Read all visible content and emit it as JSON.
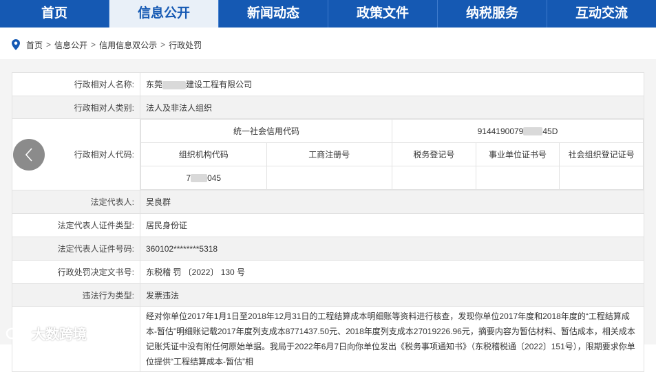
{
  "nav": {
    "items": [
      {
        "label": "首页",
        "active": false
      },
      {
        "label": "信息公开",
        "active": true
      },
      {
        "label": "新闻动态",
        "active": false
      },
      {
        "label": "政策文件",
        "active": false
      },
      {
        "label": "纳税服务",
        "active": false
      },
      {
        "label": "互动交流",
        "active": false
      }
    ]
  },
  "breadcrumb": [
    "首页",
    "信息公开",
    "信用信息双公示",
    "行政处罚"
  ],
  "breadcrumb_sep": ">",
  "table": {
    "name_label": "行政相对人名称:",
    "name_prefix": "东莞",
    "name_suffix": "建设工程有限公司",
    "type_label": "行政相对人类别:",
    "type_value": "法人及非法人组织",
    "code_label": "行政相对人代码:",
    "credit_code_header": "统一社会信用代码",
    "credit_code_prefix": "9144190079",
    "credit_code_suffix": "45D",
    "code_headers": [
      "组织机构代码",
      "工商注册号",
      "税务登记号",
      "事业单位证书号",
      "社会组织登记证号"
    ],
    "org_code_prefix": "7",
    "org_code_suffix": "045",
    "legal_rep_label": "法定代表人:",
    "legal_rep_value": "吴良群",
    "id_type_label": "法定代表人证件类型:",
    "id_type_value": "居民身份证",
    "id_no_label": "法定代表人证件号码:",
    "id_no_value": "360102********5318",
    "decision_label": "行政处罚决定文书号:",
    "decision_value": "东税稽 罚 〔2022〕 130 号",
    "violation_type_label": "违法行为类型:",
    "violation_type_value": "发票违法",
    "detail_text": "经对你单位2017年1月1日至2018年12月31日的工程结算成本明细账等资料进行核查，发现你单位2017年度和2018年度的“工程结算成本-暂估”明细账记载2017年度列支成本8771437.50元、2018年度列支成本27019226.96元，摘要内容为暂估材料、暂估成本，相关成本记账凭证中没有附任何原始单据。我局于2022年6月7日向你单位发出《税务事项通知书》（东税稽税通〔2022〕151号），限期要求你单位提供“工程结算成本-暂估”相"
  },
  "watermark": "大数跨境",
  "colors": {
    "nav_bg": "#1559b3",
    "nav_active_bg": "#e9f0f8",
    "alt_row": "#f2f2f2"
  }
}
